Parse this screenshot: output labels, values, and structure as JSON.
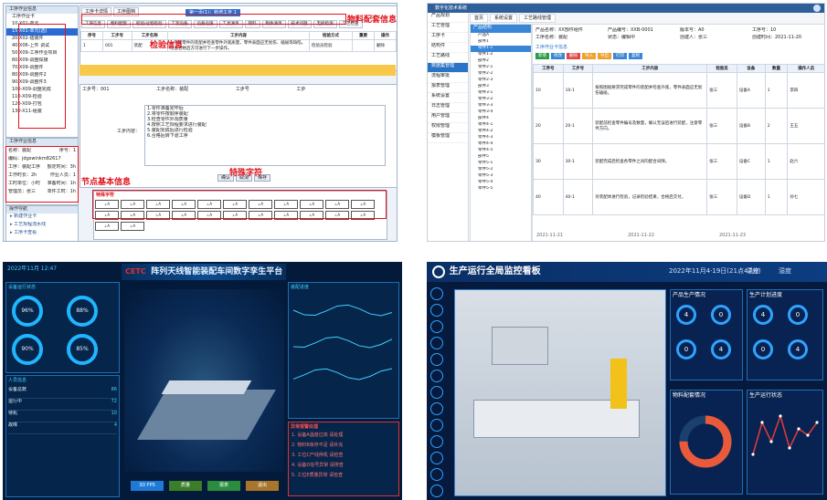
{
  "p1": {
    "tree": {
      "title": "工序作业信息",
      "items": [
        "工序作业卡",
        "10-X01-单元",
        "15-X01-单元(选)",
        "20-X02-插装件",
        "40-X06-上件 调试",
        "50-X09-工序作业项目",
        "60-X09-调整焊接",
        "70-X09-调整件",
        "80-X09-调整件2",
        "90-X09-调整件3",
        "100-X09-调整完成",
        "110-X09-检验",
        "120-X09-打包",
        "130-X11-组装"
      ],
      "selected_index": 2
    },
    "tabs": [
      "工序卡详情",
      "工序图档"
    ],
    "subtabs": [
      "工序信息",
      "物料配套",
      "检验/过程检验",
      "工装设备",
      "设备设施",
      "工具清单",
      "辅料",
      "制件清单",
      "技术问题",
      "无损检测",
      "工艺检查"
    ],
    "popup": "第一页(1)：新增工步 1",
    "grid_headers": [
      "序号",
      "工步号",
      "工步名称",
      "工步内容",
      "检验方式",
      "重要",
      "操作"
    ],
    "grid_row": [
      "1",
      "001",
      "装配",
      "1.完成零件的装配并检查零件外观质量，零件表面应无划伤、磕碰等缺陷，检查合格后方可进行下一步操作。",
      "检验员检验",
      "",
      "删除"
    ],
    "step_label": "工步号：001",
    "step_name": "工步名称：装配",
    "step_no": "工步号",
    "step_type": "工步",
    "editor_label": "工步内容：",
    "editor_lines": [
      "1.零件准备完毕后",
      "2.将零件按顺序装配",
      "3.检查零件外观质量",
      "4.按照工艺规程要求进行装配",
      "5.装配完成后进行检验",
      "6.合格后转下道工序"
    ],
    "info_title": "工序作业信息",
    "info": [
      [
        "名称：装配",
        "序号：1"
      ],
      [
        "编码：jdgswinkm82617",
        "",
        ""
      ],
      [
        "工序：装配工序",
        "额定时间：3h"
      ],
      [
        "工作时长：2h",
        "作业人员：1"
      ],
      [
        "工时单位：小时",
        "准备时间：1h"
      ],
      [
        "管理员：张三",
        "单件工时：1h"
      ]
    ],
    "nav_title": "操作导航",
    "nav": [
      "新建作业卡",
      "工艺规程流水线",
      "工序卡查看"
    ],
    "buttons": [
      "确认",
      "取消",
      "保存"
    ],
    "sym_title": "特殊字符",
    "annotations": {
      "material": "物料配套信息",
      "inspect": "检验信息",
      "basic": "节点基本信息",
      "special": "特殊字符"
    },
    "annotation_color": "#e0141c"
  },
  "p2": {
    "title": "数字化技术系统",
    "side": [
      "产品规划",
      "工艺管理",
      "工序卡",
      "结构件",
      "工艺路线",
      "数据集管理",
      "流程审批",
      "报表管理",
      "系统设置",
      "日志管理",
      "用户管理",
      "权限管理",
      "模板管理"
    ],
    "side_selected": 5,
    "tabs": [
      "首页",
      "系统设置",
      "工艺路线管理"
    ],
    "tree_title": "产品结构",
    "tree_items": [
      "产品A",
      "部件1",
      "零件1-1",
      "零件1-2",
      "部件2",
      "零件2-1",
      "零件2-2",
      "零件2-3",
      "部件3",
      "零件3-1",
      "零件3-2",
      "零件3-3",
      "零件3-4",
      "部件4",
      "零件4-1",
      "零件4-2",
      "零件4-3",
      "零件4-4",
      "零件4-5",
      "部件5",
      "零件5-1",
      "零件5-2",
      "零件5-3",
      "零件5-4",
      "零件5-5"
    ],
    "tree_selected": 2,
    "fields": [
      "产品名称：XX部件组件",
      "产品编号：XXB-0001",
      "版本号：A0",
      "工序号：10",
      "工序名称：装配",
      "状态：编辑中",
      "创建人：张三",
      "创建时间：2021-11-20"
    ],
    "section": "工序作业卡信息",
    "buttons": [
      "新增",
      "修改",
      "删除",
      "导入",
      "导出",
      "打印",
      "复制"
    ],
    "btn_colors": [
      "#2a9d49",
      "#3a86d6",
      "#e04848",
      "#f0a030",
      "#f0a030",
      "#3a86d6",
      "#3a86d6"
    ],
    "headers": [
      "工序号",
      "工步号",
      "工步内容",
      "检验员",
      "设备",
      "数量",
      "操作人员"
    ],
    "rows": [
      [
        "10",
        "10-1",
        "按照图纸要求完成零件的装配并检查外观，零件表面应无划伤磕碰。",
        "张三",
        "设备A",
        "1",
        "李四"
      ],
      [
        "20",
        "20-1",
        "装配前检查零件编号及数量，确认无误后进行装配，注意零件方向。",
        "张三",
        "设备B",
        "2",
        "王五"
      ],
      [
        "30",
        "30-1",
        "装配完成后检查各零件之间的配合间隙。",
        "张三",
        "设备C",
        "1",
        "赵六"
      ],
      [
        "40",
        "40-1",
        "对装配体进行检验，记录检验结果，合格后交付。",
        "张三",
        "设备D",
        "1",
        "孙七"
      ]
    ],
    "dates": [
      "2021-11-21",
      "2021-11-22",
      "2021-11-23"
    ]
  },
  "p3": {
    "datetime": "2022年11月 12:47",
    "title": "阵列天线智能装配车间数字孪生平台",
    "logo": "CETC",
    "labels": [
      "设备运行状态",
      "装配进度",
      "质量统计",
      "报警信息",
      "人员信息",
      "能耗监测",
      "物料配送",
      "生产统计",
      "异常报警处理"
    ],
    "rings": [
      "96%",
      "88%",
      "90%",
      "85%"
    ],
    "stats": [
      [
        "设备总数",
        "86"
      ],
      [
        "运行中",
        "72"
      ],
      [
        "待机",
        "10"
      ],
      [
        "故障",
        "4"
      ]
    ],
    "alerts": [
      "1. 设备A温度过高 请处理",
      "2. 物料B库存不足 请补充",
      "3. 工位C产线停机 请检查",
      "4. 设备D信号异常 请排查",
      "5. 工位E质量异常 请检查"
    ],
    "buttons": [
      "3D FPS",
      "质量",
      "报表",
      "退出"
    ],
    "btn_colors": [
      "#1e7ad6",
      "#3c7d2a",
      "#2a8c3c",
      "#a8752a"
    ]
  },
  "p4": {
    "title": "生产运行全局监控看板",
    "datetime": "2022年11月4·19日(21点47分)",
    "weather": [
      "温度",
      "湿度"
    ],
    "sections": [
      "产品生产情况",
      "生产计划进度",
      "物料配套情况",
      "生产运行状态"
    ],
    "product_vals": [
      "4",
      "0",
      "0",
      "4"
    ],
    "plan_vals": [
      "4",
      "0",
      "0",
      "4"
    ],
    "side_icons": 14,
    "donut_pct": 75,
    "line_points": [
      3,
      8,
      5,
      9,
      4,
      7,
      6,
      8
    ],
    "colors": {
      "accent": "#2fa3ff",
      "donut": "#e85a3a",
      "line": "#e23b3b"
    }
  }
}
